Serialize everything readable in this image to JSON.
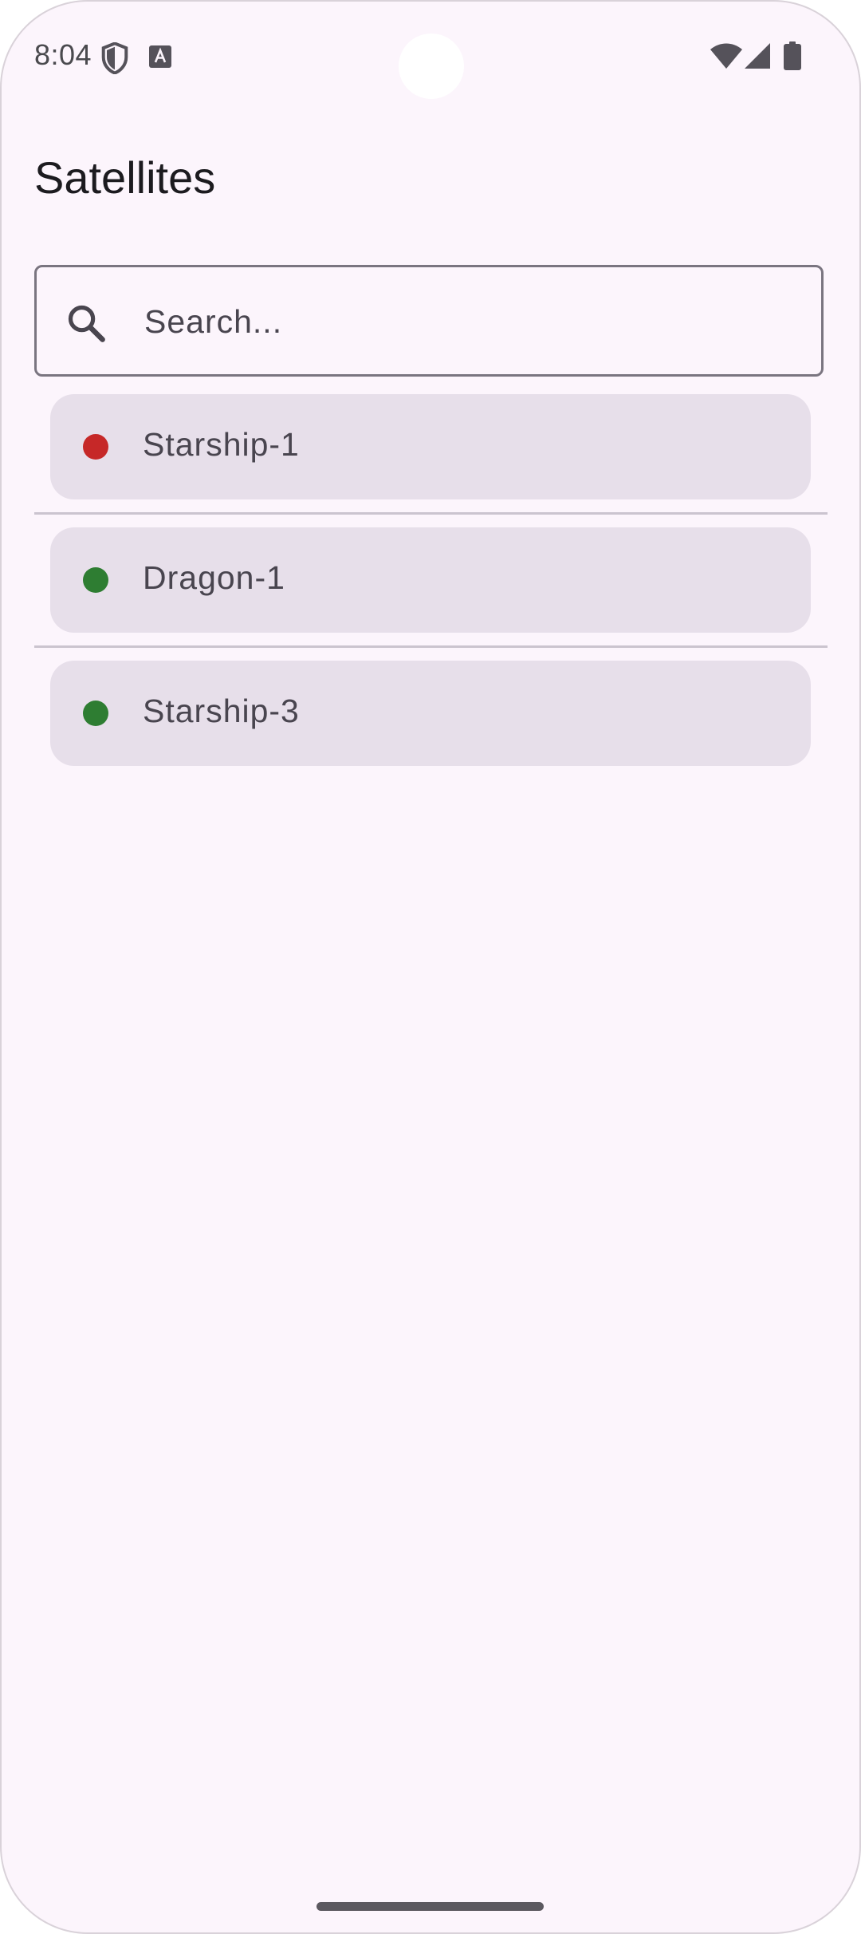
{
  "status_bar": {
    "time": "8:04",
    "icons": [
      "shield-icon",
      "a-icon",
      "wifi-icon",
      "signal-icon",
      "battery-icon"
    ]
  },
  "page": {
    "title": "Satellites"
  },
  "search": {
    "placeholder": "Search...",
    "value": "",
    "icon": "search-icon"
  },
  "satellites": [
    {
      "name": "Starship-1",
      "status_color": "#c62828"
    },
    {
      "name": "Dragon-1",
      "status_color": "#2e7d32"
    },
    {
      "name": "Starship-3",
      "status_color": "#2e7d32"
    }
  ],
  "colors": {
    "background": "#fcf5fc",
    "card": "#e7dfea",
    "inactive": "#c62828",
    "active": "#2e7d32"
  }
}
